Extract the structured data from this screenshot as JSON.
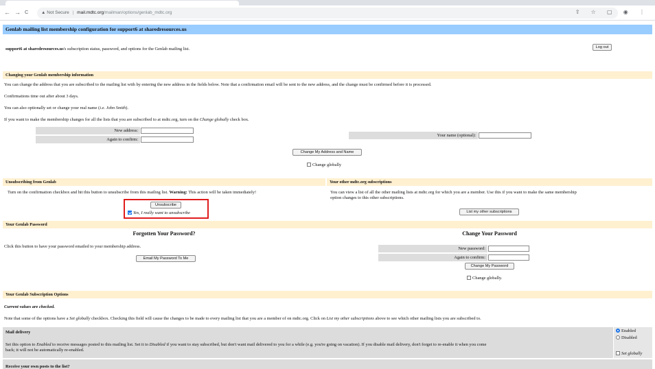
{
  "browser": {
    "back": "←",
    "forward": "→",
    "reload": "C",
    "security_label": "Not Secure",
    "url_host": "mail.mdtc.org",
    "url_path": "/mailman/options/genlab_mdtc.org",
    "right_icons": "⇧ ☆ ▢ ◉ ⋮"
  },
  "page": {
    "title": "Genlab mailing list membership configuration for support6 at sharedresources.us",
    "intro_user": "support6 at sharedresources.us",
    "intro_rest": "'s subscription status, password, and options for the Genlab mailing list.",
    "logout_label": "Log out"
  },
  "change_membership": {
    "header": "Changing your Genlab membership information",
    "para1": "You can change the address that you are subscribed to the mailing list with by entering the new address in the fields below. Note that a confirmation email will be sent to the new address, and the change must be confirmed before it is processed.",
    "para2": "Confirmations time out after about 3 days.",
    "para3_pre": "You can also optionally set or change your real name (",
    "para3_ital": "i.e. John Smith",
    "para3_post": ").",
    "para4_pre": "If you want to make the membership changes for all the lists that you are subscribed to at mdtc.org, turn on the ",
    "para4_ital": "Change globally",
    "para4_post": " check box.",
    "new_address_label": "New address:",
    "confirm_label": "Again to confirm:",
    "name_label": "Your name (optional):",
    "change_button": "Change My Address and Name",
    "change_globally": "Change globally"
  },
  "unsubscribe": {
    "header": "Unsubscribing from Genlab",
    "text_pre": "Turn on the confirmation checkbox and hit this button to unsubscribe from this mailing list. ",
    "text_warning": "Warning:",
    "text_post": " This action will be taken immediately!",
    "button": "Unsubscribe",
    "confirm_checkbox": "Yes, I really want to unsubscribe"
  },
  "other_subs": {
    "header": "Your other mdtc.org subscriptions",
    "text": "You can view a list of all the other mailing lists at mdtc.org for which you are a member. Use this if you want to make the same membership",
    "text2": "option changes to this other subscriptions.",
    "button": "List my other subscriptions"
  },
  "password": {
    "header": "Your Genlab Password",
    "forgotten_heading": "Forgotten Your Password?",
    "forgotten_text": "Click this button to have your password emailed to your membership address.",
    "email_button": "Email My Password To Me",
    "change_heading": "Change Your Password",
    "new_pw_label": "New password:",
    "confirm_pw_label": "Again to confirm:",
    "change_button": "Change My Password",
    "change_globally": "Change globally."
  },
  "options": {
    "header": "Your Genlab Subscription Options",
    "checked_note": "Current values are checked.",
    "note_pre": "Note that some of the options have a ",
    "note_ital1": "Set globally",
    "note_mid1": " checkbox. Checking this field will cause the changes to be made to every mailing list that you are a member of on mdtc.org. Click on ",
    "note_ital2": "List my other subscriptions",
    "note_post": " above to see which other mailing lists you are subscribed to.",
    "mail_delivery_title": "Mail delivery",
    "mail_delivery_text_pre": "Set this option to ",
    "mail_delivery_ital1": "Enabled",
    "mail_delivery_mid1": " to receive messages posted to this mailing list. Set it to ",
    "mail_delivery_ital2": "Disabled",
    "mail_delivery_post": " if you want to stay subscribed, but don't want mail delivered to you for a while (e.g. you're going on vacation). If you disable mail delivery, don't forget to re-enable it when you come",
    "mail_delivery_post2": "back; it will not be automatically re-enabled.",
    "enabled_label": "Enabled",
    "disabled_label": "Disabled",
    "set_globally": "Set globally",
    "next_row_title": "Receive your own posts to the list?"
  }
}
